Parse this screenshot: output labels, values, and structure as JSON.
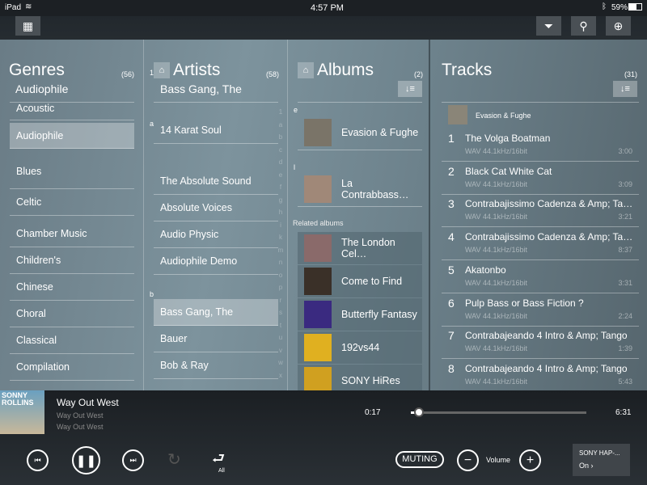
{
  "status": {
    "device": "iPad",
    "time": "4:57 PM",
    "battery": "59%"
  },
  "toolbar": {
    "icons": [
      "grid-icon",
      "filter-icon",
      "search-icon",
      "add-to-queue-icon"
    ]
  },
  "genres": {
    "title": "Genres",
    "count": "(56)",
    "selected": "Audiophile",
    "items": [
      "Acoustic",
      "Audiophile",
      "Blues",
      "Celtic",
      "Chamber Music",
      "Children's",
      "Chinese",
      "Choral",
      "Classical",
      "Compilation"
    ]
  },
  "artists": {
    "title": "Artists",
    "count": "(58)",
    "selected": "Bass Gang, The",
    "sections": [
      "1",
      "a",
      "b"
    ],
    "items": [
      "14 Karat Soul",
      "The Absolute Sound",
      "Absolute Voices",
      "Audio Physic",
      "Audiophile Demo",
      "Bass Gang, The",
      "Bauer",
      "Bob & Ray"
    ],
    "index": [
      "1",
      "a",
      "b",
      "c",
      "d",
      "e",
      "f",
      "g",
      "h",
      "i",
      "k",
      "m",
      "n",
      "o",
      "p",
      "r",
      "s",
      "t",
      "u",
      "v",
      "w",
      "x"
    ]
  },
  "albums": {
    "title": "Albums",
    "count": "(2)",
    "sections": [
      "e",
      "l"
    ],
    "items": [
      "Evasion & Fughe",
      "La Contrabbass…"
    ],
    "related_label": "Related albums",
    "related": [
      "The London Cel…",
      "Come to Find",
      "Butterfly Fantasy",
      "192vs44",
      "SONY HiRes"
    ]
  },
  "tracks": {
    "title": "Tracks",
    "count": "(31)",
    "album": "Evasion & Fughe",
    "items": [
      {
        "n": "1",
        "title": "The Volga Boatman",
        "format": "WAV 44.1kHz/16bit",
        "duration": "3:00"
      },
      {
        "n": "2",
        "title": "Black Cat White Cat",
        "format": "WAV 44.1kHz/16bit",
        "duration": "3:09"
      },
      {
        "n": "3",
        "title": "Contrabajissimo Cadenza & Amp; Ta…",
        "format": "WAV 44.1kHz/16bit",
        "duration": "3:21"
      },
      {
        "n": "4",
        "title": "Contrabajissimo Cadenza & Amp; Ta…",
        "format": "WAV 44.1kHz/16bit",
        "duration": "8:37"
      },
      {
        "n": "5",
        "title": "Akatonbo",
        "format": "WAV 44.1kHz/16bit",
        "duration": "3:31"
      },
      {
        "n": "6",
        "title": "Pulp Bass or Bass Fiction ?",
        "format": "WAV 44.1kHz/16bit",
        "duration": "2:24"
      },
      {
        "n": "7",
        "title": "Contrabajeando 4 Intro & Amp; Tango",
        "format": "WAV 44.1kHz/16bit",
        "duration": "1:39"
      },
      {
        "n": "8",
        "title": "Contrabajeando 4 Intro & Amp; Tango",
        "format": "WAV 44.1kHz/16bit",
        "duration": "5:43"
      }
    ]
  },
  "player": {
    "title": "Way Out West",
    "album": "Way Out West",
    "artist": "Way Out West",
    "elapsed": "0:17",
    "total": "6:31",
    "progress": 0.044,
    "repeat_label": "All",
    "muting": "MUTING",
    "volume": "Volume",
    "device": "SONY HAP-...",
    "device_state": "On"
  }
}
